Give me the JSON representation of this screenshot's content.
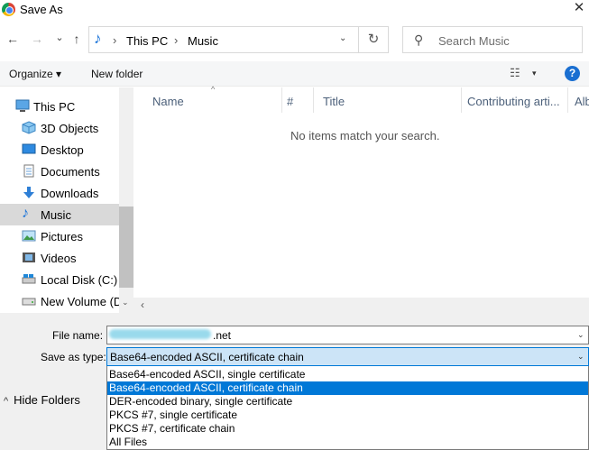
{
  "window": {
    "title": "Save As",
    "close_glyph": "✕"
  },
  "navbar": {
    "back_glyph": "←",
    "forward_glyph": "→",
    "recent_glyph": "⌄",
    "up_glyph": "↑",
    "address": {
      "crumbs": [
        "This PC",
        "Music"
      ],
      "separator": "›",
      "dropdown_glyph": "⌄"
    },
    "refresh_glyph": "↻",
    "search": {
      "placeholder": "Search Music",
      "icon_glyph": "⚲"
    }
  },
  "toolbar": {
    "organize_label": "Organize ▾",
    "new_folder_label": "New folder",
    "view_glyph": "☷",
    "view_dd_glyph": "▾",
    "help_glyph": "?"
  },
  "nav_pane": {
    "items": [
      {
        "label": "This PC",
        "icon": "pc-icon"
      },
      {
        "label": "3D Objects",
        "icon": "cube-icon"
      },
      {
        "label": "Desktop",
        "icon": "desktop-icon"
      },
      {
        "label": "Documents",
        "icon": "documents-icon"
      },
      {
        "label": "Downloads",
        "icon": "download-icon"
      },
      {
        "label": "Music",
        "icon": "music-icon"
      },
      {
        "label": "Pictures",
        "icon": "pictures-icon"
      },
      {
        "label": "Videos",
        "icon": "videos-icon"
      },
      {
        "label": "Local Disk (C:)",
        "icon": "disk-icon"
      },
      {
        "label": "New Volume (D",
        "icon": "drive-icon"
      }
    ],
    "selected": "Music"
  },
  "content": {
    "columns": [
      "Name",
      "#",
      "Title",
      "Contributing arti...",
      "Alb"
    ],
    "empty_message": "No items match your search."
  },
  "form": {
    "file_name_label": "File name:",
    "file_name_value": ".net",
    "save_type_label": "Save as type:",
    "save_type_value": "Base64-encoded ASCII, certificate chain",
    "type_options": [
      "Base64-encoded ASCII, single certificate",
      "Base64-encoded ASCII, certificate chain",
      "DER-encoded binary, single certificate",
      "PKCS #7, single certificate",
      "PKCS #7, certificate chain",
      "All Files"
    ],
    "selected_option_index": 1
  },
  "footer": {
    "hide_folders_label": "Hide Folders"
  },
  "colors": {
    "accent": "#0078d7",
    "selection_bg": "#cce4f7",
    "help": "#1a6fd1"
  }
}
